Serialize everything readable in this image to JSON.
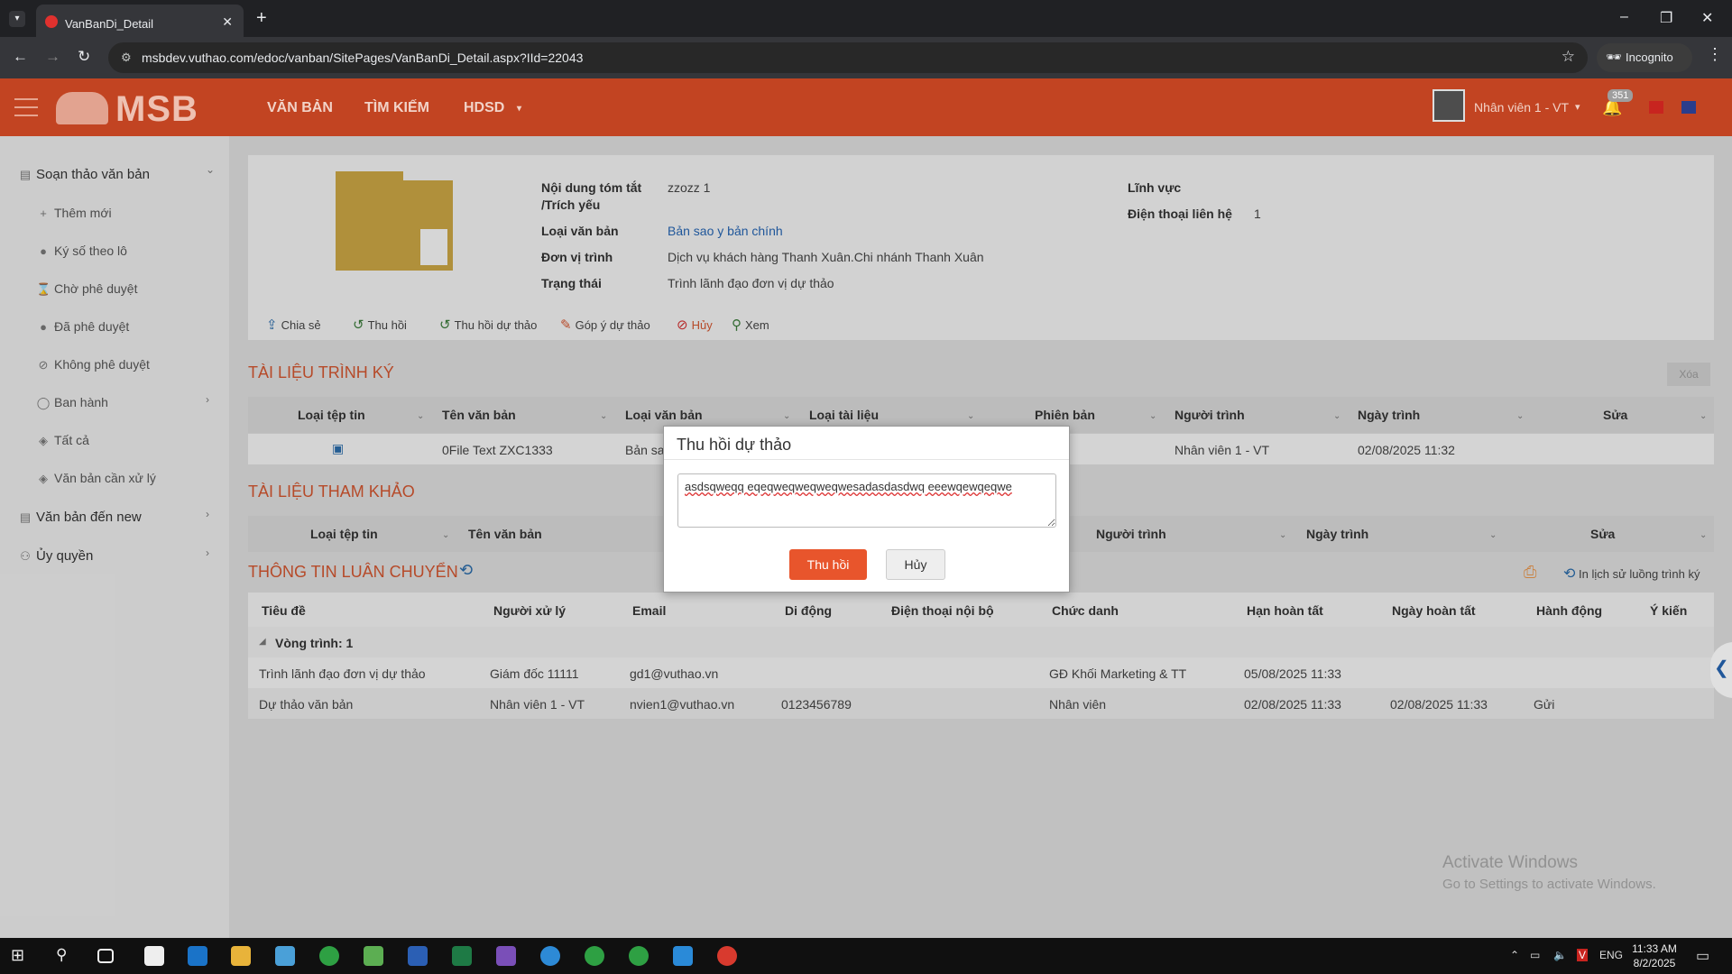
{
  "browser": {
    "tab_title": "VanBanDi_Detail",
    "url": "msbdev.vuthao.com/edoc/vanban/SitePages/VanBanDi_Detail.aspx?IId=22043",
    "incognito_label": "Incognito"
  },
  "header": {
    "logo_text": "MSB",
    "nav": [
      "VĂN BẢN",
      "TÌM KIẾM",
      "HDSD"
    ],
    "user_name": "Nhân viên 1 - VT",
    "notification_count": "351",
    "brand_color": "#c24422"
  },
  "sidebar": {
    "group1": "Soạn thảo văn bản",
    "items": [
      "Thêm mới",
      "Ký số theo lô",
      "Chờ phê duyệt",
      "Đã phê duyệt",
      "Không phê duyệt",
      "Ban hành",
      "Tất cả",
      "Văn bản cần xử lý"
    ],
    "group2": "Văn bản đến new",
    "group3": "Ủy quyền"
  },
  "doc": {
    "summary_label": "Nội dung tóm tắt",
    "summary_label2": "/Trích yếu",
    "summary_value": "zzozz 1",
    "type_label": "Loại văn bản",
    "type_value": "Bản sao y bản chính",
    "unit_label": "Đơn vị trình",
    "unit_value": "Dịch vụ khách hàng Thanh Xuân.Chi nhánh Thanh Xuân",
    "status_label": "Trạng thái",
    "status_value": "Trình lãnh đạo đơn vị dự thảo",
    "field_label": "Lĩnh vực",
    "phone_label": "Điện thoại liên hệ",
    "phone_value": "1"
  },
  "actions": [
    "Chia sẻ",
    "Thu hồi",
    "Thu hồi dự thảo",
    "Góp ý dự thảo",
    "Hủy",
    "Xem"
  ],
  "sections": {
    "sign_docs": "TÀI LIỆU TRÌNH KÝ",
    "ref_docs": "TÀI LIỆU THAM KHẢO",
    "flow": "THÔNG TIN LUÂN CHUYỂN",
    "delete_button": "Xóa",
    "history_print": "In lịch sử luồng trình ký"
  },
  "sign_table": {
    "headers": [
      "Loại tệp tin",
      "Tên văn bản",
      "Loại văn bản",
      "Loại tài liệu",
      "Phiên bản",
      "Người trình",
      "Ngày trình",
      "Sửa"
    ],
    "row": {
      "name": "0File Text ZXC1333",
      "type": "Bản sa",
      "submitter": "Nhân viên 1 - VT",
      "date": "02/08/2025 11:32"
    }
  },
  "ref_table": {
    "headers": [
      "Loại tệp tin",
      "Tên văn bản",
      "Người trình",
      "Ngày trình",
      "Sửa"
    ]
  },
  "flow_table": {
    "headers": [
      "Tiêu đề",
      "Người xử lý",
      "Email",
      "Di động",
      "Điện thoại nội bộ",
      "Chức danh",
      "Hạn hoàn tất",
      "Ngày hoàn tất",
      "Hành động",
      "Ý kiến"
    ],
    "group": "Vòng trình: 1",
    "rows": [
      {
        "title": "Trình lãnh đạo đơn vị dự thảo",
        "handler": "Giám đốc 11111",
        "email": "gd1@vuthao.vn",
        "mobile": "",
        "role": "GĐ Khối Marketing & TT",
        "due": "05/08/2025 11:33",
        "done": "",
        "action": ""
      },
      {
        "title": "Dự thảo văn bản",
        "handler": "Nhân viên 1 - VT",
        "email": "nvien1@vuthao.vn",
        "mobile": "0123456789",
        "role": "Nhân viên",
        "due": "02/08/2025 11:33",
        "done": "02/08/2025 11:33",
        "action": "Gửi"
      }
    ]
  },
  "modal": {
    "title": "Thu hồi dự thảo",
    "text": "asdsqweqq eqeqweqweqweqwesadasdasdwq eeewqewqeqwe",
    "confirm": "Thu hồi",
    "cancel": "Hủy"
  },
  "watermark": {
    "line1": "Activate Windows",
    "line2": "Go to Settings to activate Windows."
  },
  "taskbar": {
    "lang": "ENG",
    "time": "11:33 AM",
    "date": "8/2/2025"
  }
}
